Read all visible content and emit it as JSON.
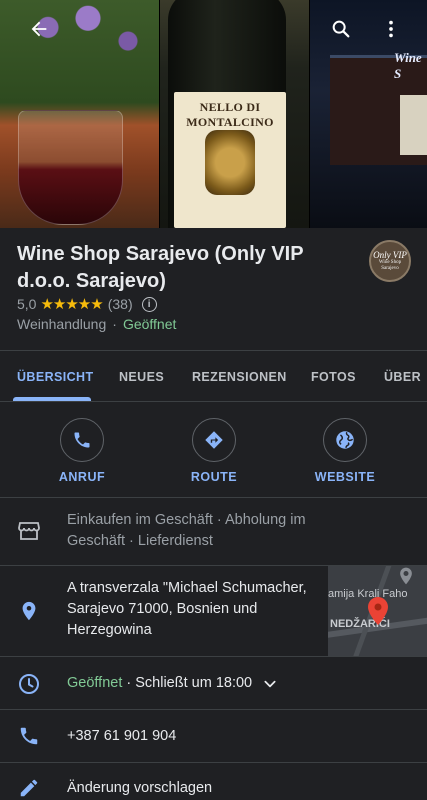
{
  "header": {
    "storefront_sign": "Wine S",
    "bottle_label": "NELLO DI MONTALCINO"
  },
  "place": {
    "name": "Wine Shop Sarajevo (Only VIP d.o.o. Sarajevo)",
    "logo_text": "Only VIP",
    "logo_subtext": "Wine Shop Sarajevo",
    "rating": "5,0",
    "stars": "★★★★★",
    "review_count": "(38)",
    "category": "Weinhandlung",
    "separator": "·",
    "open_status": "Geöffnet"
  },
  "tabs": [
    {
      "label": "ÜBERSICHT",
      "active": true
    },
    {
      "label": "NEUES"
    },
    {
      "label": "REZENSIONEN"
    },
    {
      "label": "FOTOS"
    },
    {
      "label": "ÜBER"
    }
  ],
  "actions": {
    "call": "ANRUF",
    "route": "ROUTE",
    "website": "WEBSITE"
  },
  "info": {
    "services_line1": "Einkaufen im Geschäft · Abholung im",
    "services_line2": "Geschäft · Lieferdienst",
    "address_line1": "A transverzala \"Michael Schumacher,",
    "address_line2": "Sarajevo 71000, Bosnien und",
    "address_line3": "Herzegowina",
    "hours_status": "Geöffnet",
    "hours_rest": " · Schließt um 18:00",
    "phone": "+387 61 901 904",
    "suggest_edit": "Änderung vorschlagen"
  },
  "map": {
    "label_1": "amija Kralj Faho",
    "label_2": "NEDŽARIĆI"
  },
  "colors": {
    "background": "#1f2023",
    "accent": "#8ab4f8",
    "open_green": "#81c995",
    "star": "#f6bb0c",
    "pin_red": "#ea4335"
  },
  "icons": [
    "back-arrow-icon",
    "search-icon",
    "more-vert-icon",
    "info-icon",
    "phone-icon",
    "directions-icon",
    "globe-icon",
    "storefront-icon",
    "location-pin-icon",
    "clock-icon",
    "chevron-down-icon",
    "pencil-icon"
  ]
}
